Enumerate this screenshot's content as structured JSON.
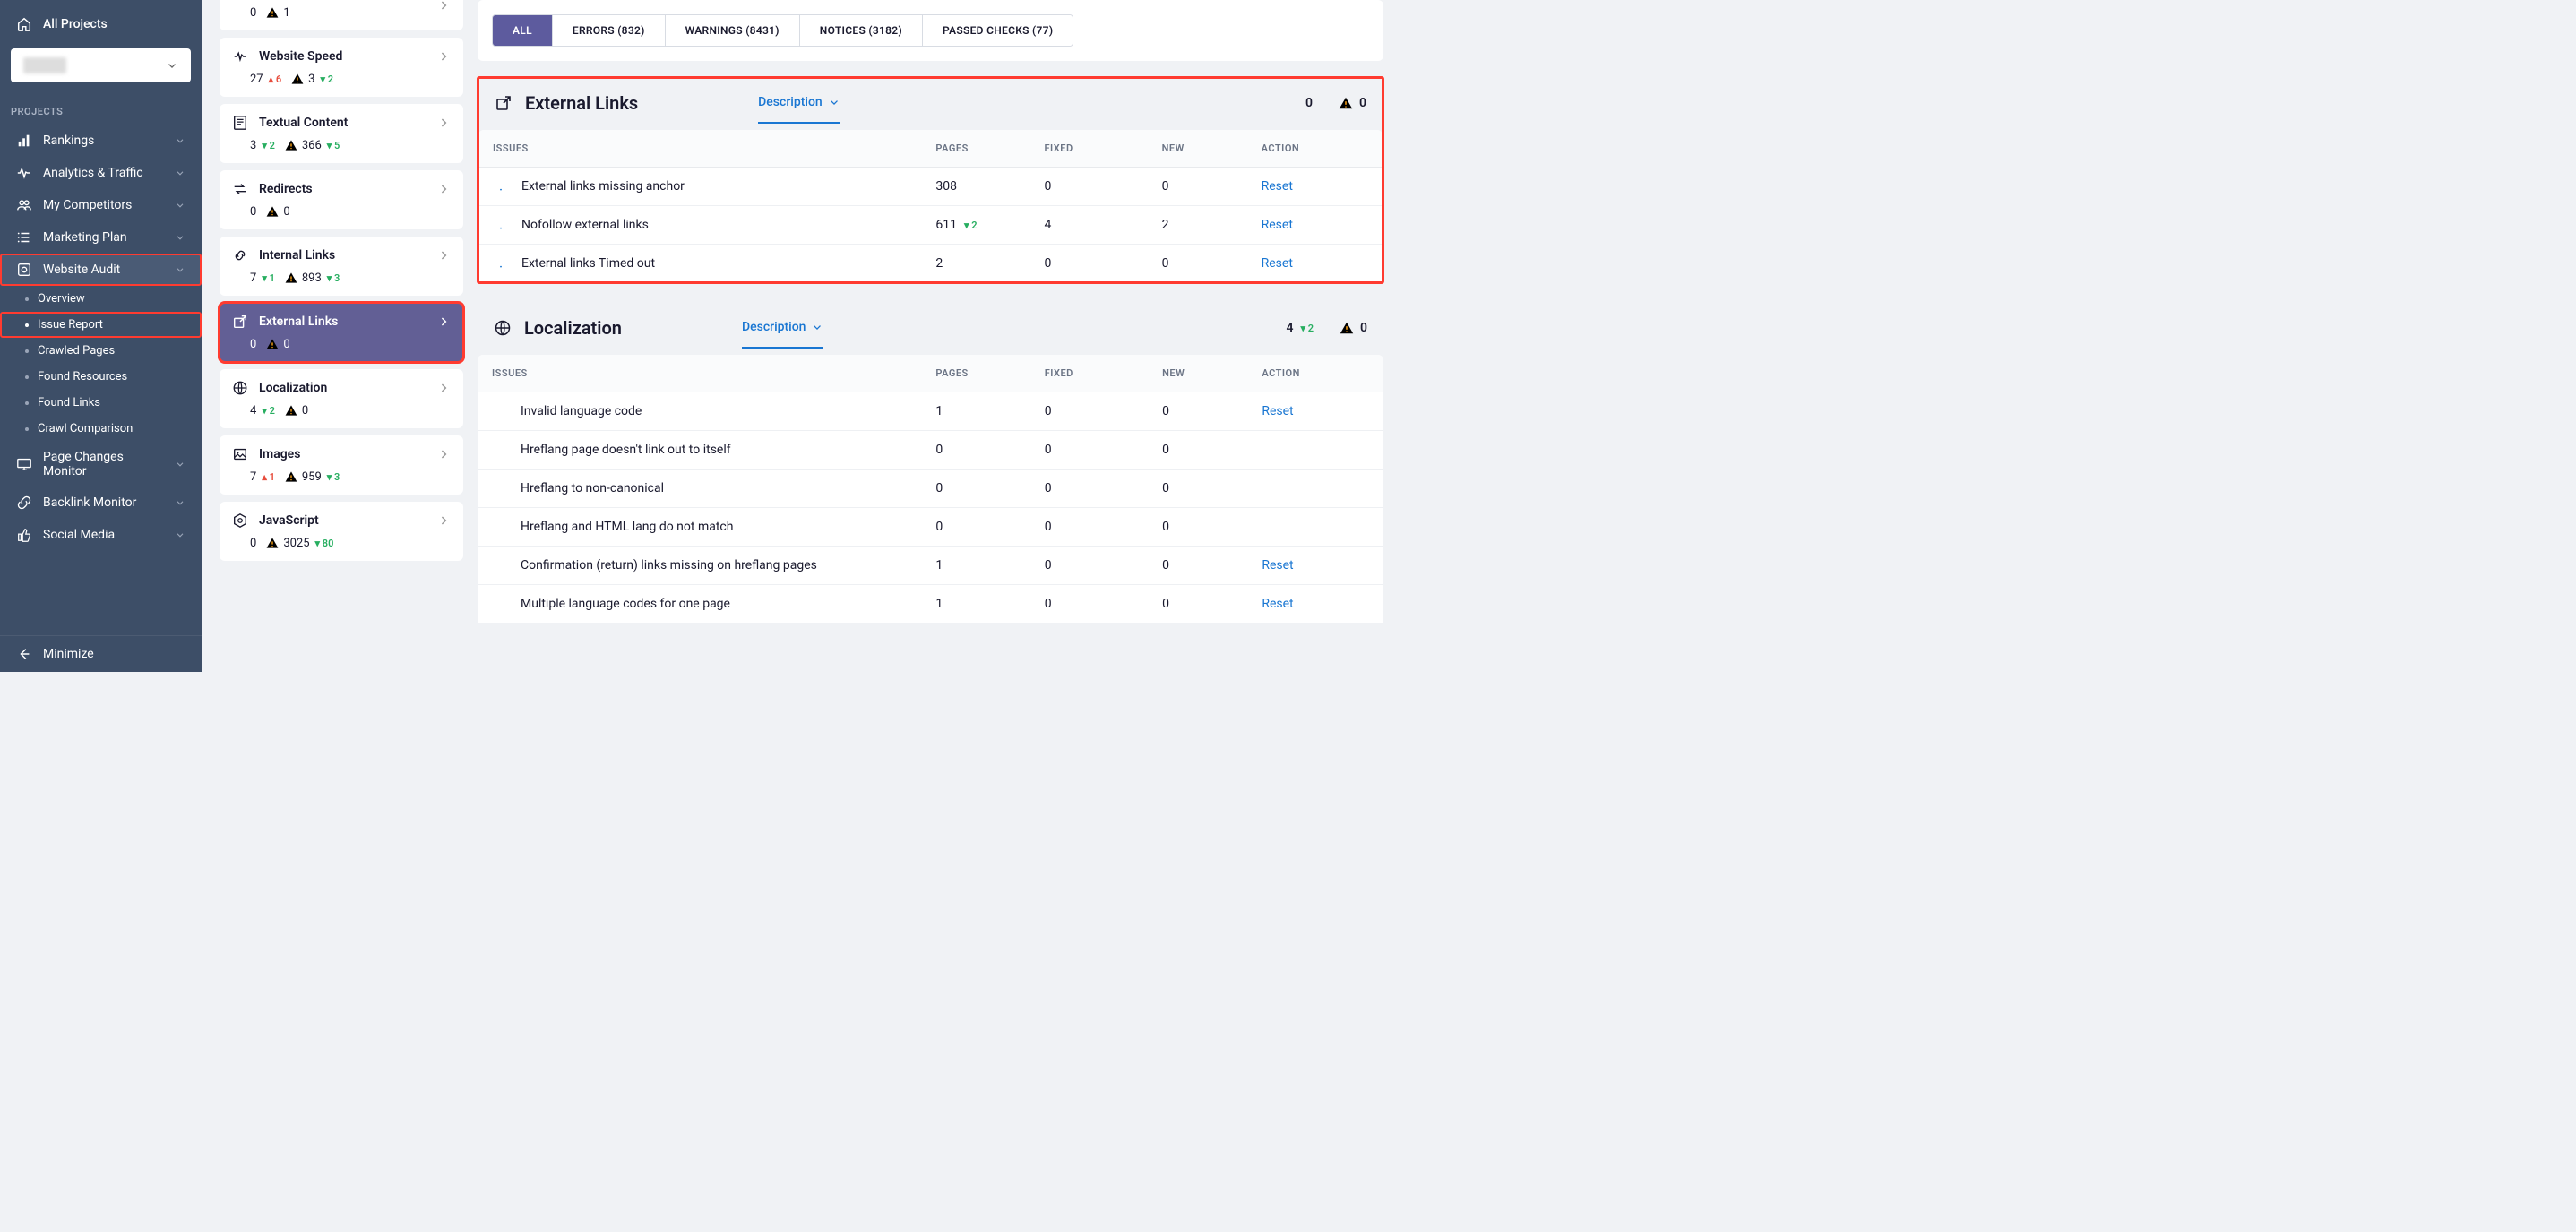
{
  "sidebar": {
    "all_projects": "All Projects",
    "projects_label": "PROJECTS",
    "nav": [
      {
        "label": "Rankings",
        "icon": "bars"
      },
      {
        "label": "Analytics & Traffic",
        "icon": "pulse"
      },
      {
        "label": "My Competitors",
        "icon": "people"
      },
      {
        "label": "Marketing Plan",
        "icon": "list"
      },
      {
        "label": "Website Audit",
        "icon": "target",
        "expanded": true,
        "highlight": true
      },
      {
        "label": "Page Changes Monitor",
        "icon": "monitor"
      },
      {
        "label": "Backlink Monitor",
        "icon": "link"
      },
      {
        "label": "Social Media",
        "icon": "thumb"
      }
    ],
    "audit_sub": [
      {
        "label": "Overview"
      },
      {
        "label": "Issue Report",
        "active": true,
        "highlight": true
      },
      {
        "label": "Crawled Pages"
      },
      {
        "label": "Found Resources"
      },
      {
        "label": "Found Links"
      },
      {
        "label": "Crawl Comparison"
      }
    ],
    "minimize": "Minimize"
  },
  "filters": [
    {
      "label": "ALL",
      "active": true
    },
    {
      "label": "ERRORS (832)"
    },
    {
      "label": "WARNINGS (8431)"
    },
    {
      "label": "NOTICES (3182)"
    },
    {
      "label": "PASSED CHECKS (77)"
    }
  ],
  "partial_card": {
    "errors": "0",
    "warnings": "1"
  },
  "categories": [
    {
      "title": "Website Speed",
      "icon": "speed",
      "errors": "27",
      "err_delta": "▴ 6",
      "err_dir": "up",
      "warnings": "3",
      "warn_delta": "▾ 2",
      "warn_dir": "down"
    },
    {
      "title": "Textual Content",
      "icon": "textual",
      "errors": "3",
      "err_delta": "▾ 2",
      "err_dir": "down",
      "warnings": "366",
      "warn_delta": "▾ 5",
      "warn_dir": "down"
    },
    {
      "title": "Redirects",
      "icon": "redirects",
      "errors": "0",
      "warnings": "0"
    },
    {
      "title": "Internal Links",
      "icon": "intlink",
      "errors": "7",
      "err_delta": "▾ 1",
      "err_dir": "down",
      "warnings": "893",
      "warn_delta": "▾ 3",
      "warn_dir": "down"
    },
    {
      "title": "External Links",
      "icon": "extlink",
      "errors": "0",
      "warnings": "0",
      "selected": true,
      "highlight": true
    },
    {
      "title": "Localization",
      "icon": "globe",
      "errors": "4",
      "err_delta": "▾ 2",
      "err_dir": "down",
      "warnings": "0"
    },
    {
      "title": "Images",
      "icon": "image",
      "errors": "7",
      "err_delta": "▴ 1",
      "err_dir": "up",
      "warnings": "959",
      "warn_delta": "▾ 3",
      "warn_dir": "down"
    },
    {
      "title": "JavaScript",
      "icon": "js",
      "errors": "0",
      "warnings": "3025",
      "warn_delta": "▾ 80",
      "warn_dir": "down"
    }
  ],
  "sections": [
    {
      "title": "External Links",
      "desc_label": "Description",
      "icon": "extlink",
      "highlight": true,
      "meta_err": "0",
      "meta_warn": "0",
      "columns": {
        "issues": "ISSUES",
        "pages": "PAGES",
        "fixed": "FIXED",
        "new": "NEW",
        "action": "ACTION"
      },
      "rows": [
        {
          "icon": "notice",
          "name": "External links missing anchor",
          "pages": "308",
          "fixed": "0",
          "new": "0",
          "action": "Reset"
        },
        {
          "icon": "notice",
          "name": "Nofollow external links",
          "pages": "611",
          "pages_delta": "▾ 2",
          "pages_dir": "down",
          "fixed": "4",
          "new": "2",
          "action": "Reset"
        },
        {
          "icon": "notice",
          "name": "External links Timed out",
          "pages": "2",
          "fixed": "0",
          "new": "0",
          "action": "Reset"
        }
      ]
    },
    {
      "title": "Localization",
      "desc_label": "Description",
      "icon": "globe",
      "meta_err": "4",
      "meta_err_delta": "▾ 2",
      "meta_err_dir": "down",
      "meta_warn": "0",
      "columns": {
        "issues": "ISSUES",
        "pages": "PAGES",
        "fixed": "FIXED",
        "new": "NEW",
        "action": "ACTION"
      },
      "rows": [
        {
          "icon": "error",
          "name": "Invalid language code",
          "pages": "1",
          "fixed": "0",
          "new": "0",
          "action": "Reset"
        },
        {
          "icon": "pass",
          "name": "Hreflang page doesn't link out to itself",
          "pages": "0",
          "fixed": "0",
          "new": "0"
        },
        {
          "icon": "pass",
          "name": "Hreflang to non-canonical",
          "pages": "0",
          "fixed": "0",
          "new": "0"
        },
        {
          "icon": "pass",
          "name": "Hreflang and HTML lang do not match",
          "pages": "0",
          "fixed": "0",
          "new": "0"
        },
        {
          "icon": "error",
          "name": "Confirmation (return) links missing on hreflang pages",
          "pages": "1",
          "fixed": "0",
          "new": "0",
          "action": "Reset"
        },
        {
          "icon": "error",
          "name": "Multiple language codes for one page",
          "pages": "1",
          "fixed": "0",
          "new": "0",
          "action": "Reset"
        }
      ]
    }
  ]
}
